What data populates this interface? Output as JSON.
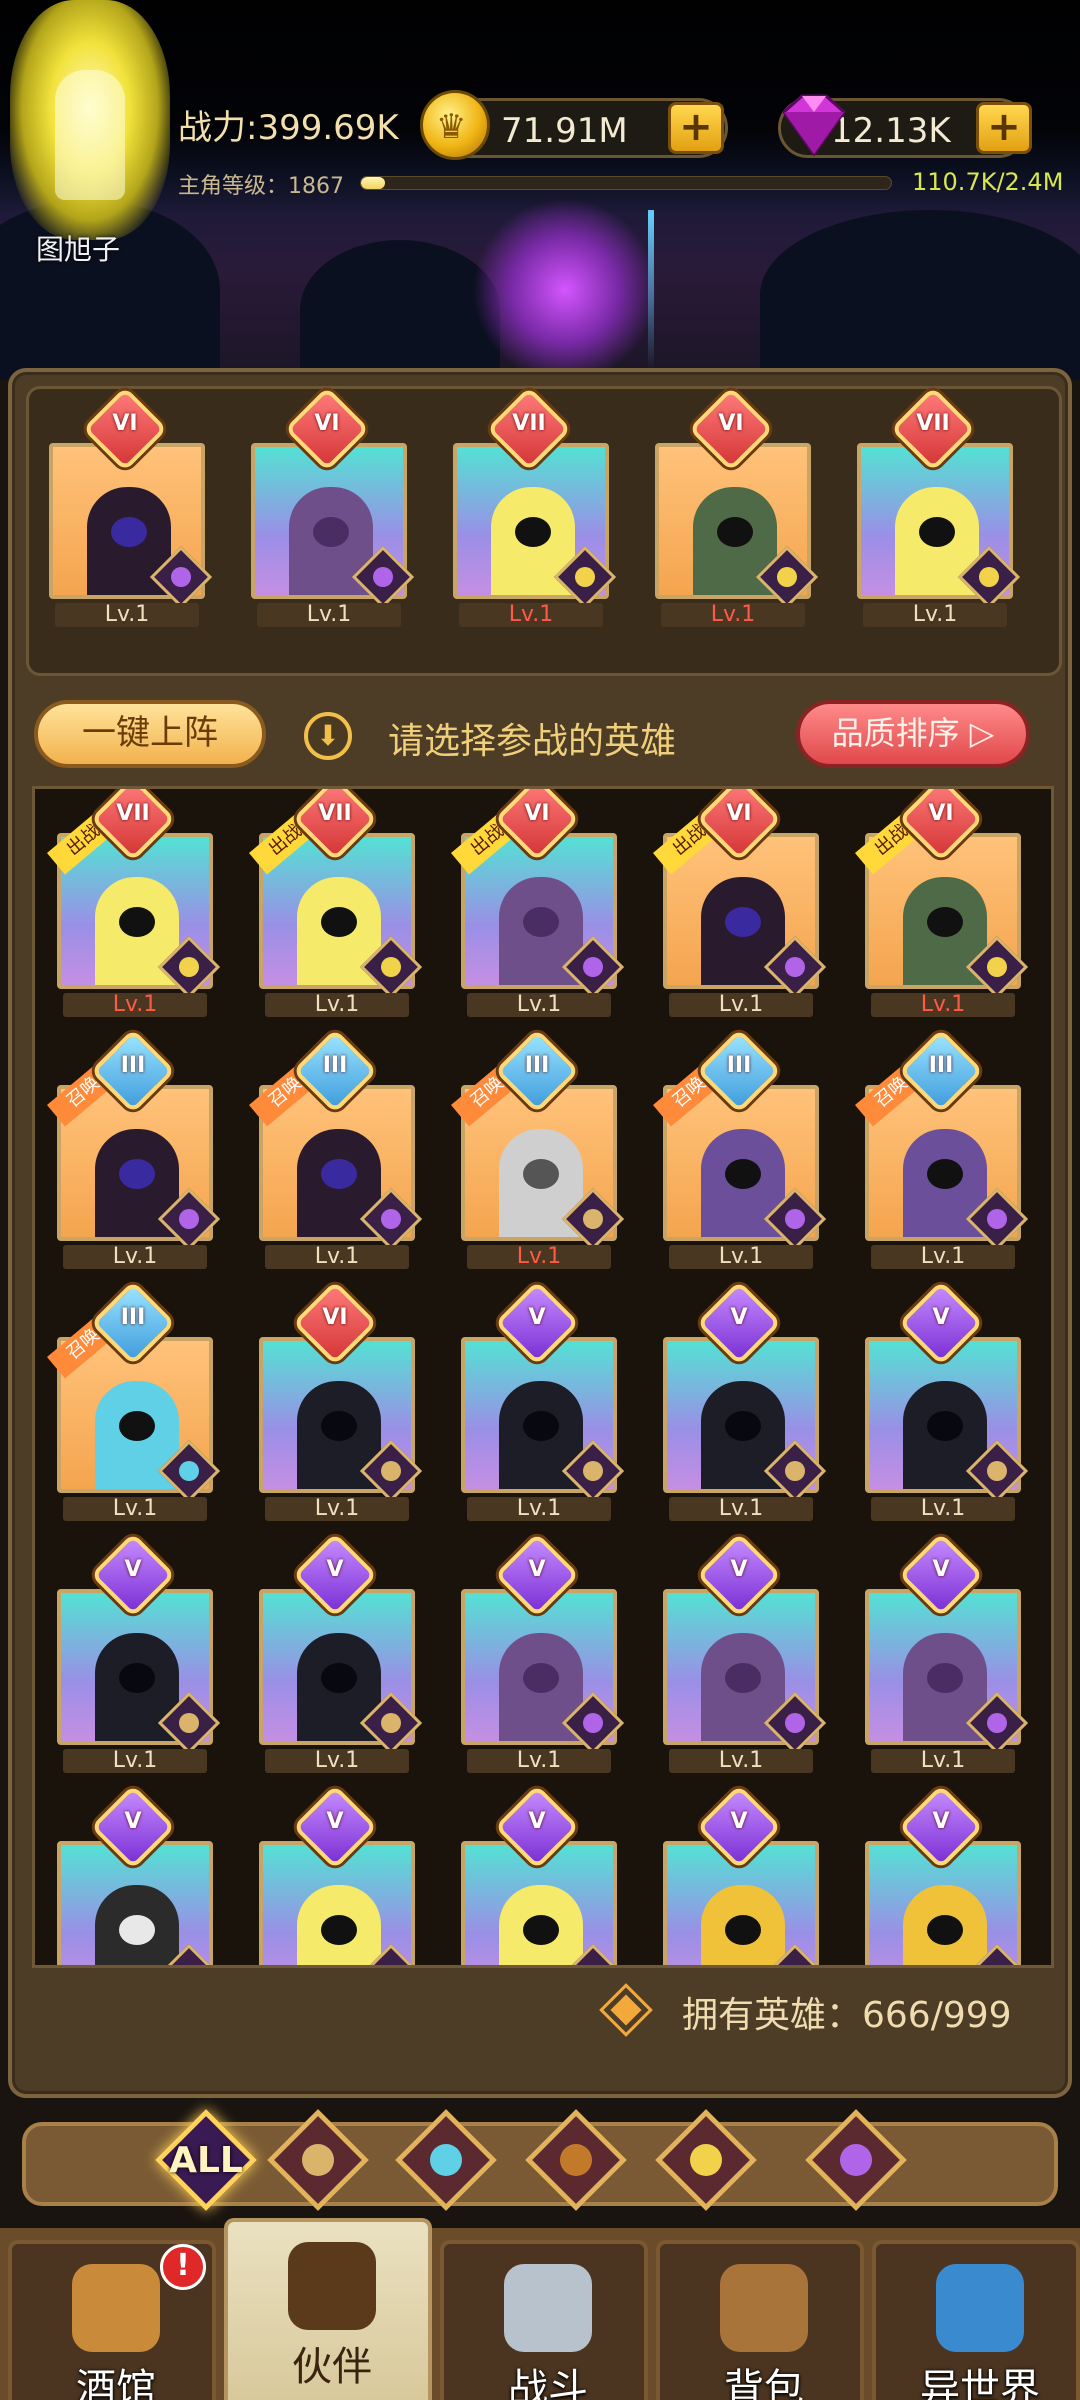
{
  "player": {
    "name": "图旭子",
    "power": "战力:399.69K",
    "level_label": "主角等级：1867",
    "level_progress": 0.046,
    "xp": "110.7K/2.4M",
    "gold": "71.91M",
    "gems": "12.13K"
  },
  "toolbar": {
    "auto_deploy": "一键上阵",
    "hint": "请选择参战的英雄",
    "sort": "品质排序"
  },
  "owned": "拥有英雄：666/999",
  "lineup": [
    {
      "rank": "VI",
      "badge": "red",
      "bg": "orange",
      "figure": "dark",
      "class": "demon",
      "level": "Lv.1",
      "level_red": false
    },
    {
      "rank": "VI",
      "badge": "red",
      "bg": "cyan",
      "figure": "purple",
      "class": "demon",
      "level": "Lv.1",
      "level_red": false
    },
    {
      "rank": "VII",
      "badge": "red",
      "bg": "cyan",
      "figure": "yellow",
      "class": "elf",
      "level": "Lv.1",
      "level_red": true
    },
    {
      "rank": "VI",
      "badge": "red",
      "bg": "orange",
      "figure": "green",
      "class": "elf",
      "level": "Lv.1",
      "level_red": true
    },
    {
      "rank": "VII",
      "badge": "red",
      "bg": "cyan",
      "figure": "yellow",
      "class": "elf",
      "level": "Lv.1",
      "level_red": false
    }
  ],
  "heroes": [
    {
      "rank": "VII",
      "badge": "red",
      "bg": "cyan",
      "figure": "yellow",
      "class": "elf",
      "level": "Lv.1",
      "level_red": true,
      "tag": "出战中",
      "tag_color": "yellow"
    },
    {
      "rank": "VII",
      "badge": "red",
      "bg": "cyan",
      "figure": "yellow",
      "class": "elf",
      "level": "Lv.1",
      "level_red": false,
      "tag": "出战中",
      "tag_color": "yellow"
    },
    {
      "rank": "VI",
      "badge": "red",
      "bg": "cyan",
      "figure": "purple",
      "class": "demon",
      "level": "Lv.1",
      "level_red": false,
      "tag": "出战中",
      "tag_color": "yellow"
    },
    {
      "rank": "VI",
      "badge": "red",
      "bg": "orange",
      "figure": "dark",
      "class": "demon",
      "level": "Lv.1",
      "level_red": false,
      "tag": "出战中",
      "tag_color": "yellow"
    },
    {
      "rank": "VI",
      "badge": "red",
      "bg": "orange",
      "figure": "green",
      "class": "elf",
      "level": "Lv.1",
      "level_red": true,
      "tag": "出战中",
      "tag_color": "yellow"
    },
    {
      "rank": "III",
      "badge": "blue",
      "bg": "orange",
      "figure": "dark",
      "class": "demon",
      "level": "Lv.1",
      "level_red": false,
      "tag": "召唤中",
      "tag_color": "orange"
    },
    {
      "rank": "III",
      "badge": "blue",
      "bg": "orange",
      "figure": "dark",
      "class": "demon",
      "level": "Lv.1",
      "level_red": false,
      "tag": "召唤中",
      "tag_color": "orange"
    },
    {
      "rank": "III",
      "badge": "blue",
      "bg": "orange",
      "figure": "knight",
      "class": "warrior",
      "level": "Lv.1",
      "level_red": true,
      "tag": "召唤中",
      "tag_color": "orange"
    },
    {
      "rank": "III",
      "badge": "blue",
      "bg": "orange",
      "figure": "orc",
      "class": "demon",
      "level": "Lv.1",
      "level_red": false,
      "tag": "召唤中",
      "tag_color": "orange"
    },
    {
      "rank": "III",
      "badge": "blue",
      "bg": "orange",
      "figure": "orc",
      "class": "demon",
      "level": "Lv.1",
      "level_red": false,
      "tag": "召唤中",
      "tag_color": "orange"
    },
    {
      "rank": "III",
      "badge": "blue",
      "bg": "orange",
      "figure": "fish",
      "class": "fish",
      "level": "Lv.1",
      "level_red": false,
      "tag": "召唤中",
      "tag_color": "orange"
    },
    {
      "rank": "VI",
      "badge": "red",
      "bg": "cyan",
      "figure": "hood",
      "class": "warrior",
      "level": "Lv.1",
      "level_red": false,
      "tag": "",
      "tag_color": ""
    },
    {
      "rank": "V",
      "badge": "purple",
      "bg": "cyan",
      "figure": "hood",
      "class": "warrior",
      "level": "Lv.1",
      "level_red": false,
      "tag": "",
      "tag_color": ""
    },
    {
      "rank": "V",
      "badge": "purple",
      "bg": "cyan",
      "figure": "hood",
      "class": "warrior",
      "level": "Lv.1",
      "level_red": false,
      "tag": "",
      "tag_color": ""
    },
    {
      "rank": "V",
      "badge": "purple",
      "bg": "cyan",
      "figure": "hood",
      "class": "warrior",
      "level": "Lv.1",
      "level_red": false,
      "tag": "",
      "tag_color": ""
    },
    {
      "rank": "V",
      "badge": "purple",
      "bg": "cyan",
      "figure": "hood",
      "class": "warrior",
      "level": "Lv.1",
      "level_red": false,
      "tag": "",
      "tag_color": ""
    },
    {
      "rank": "V",
      "badge": "purple",
      "bg": "cyan",
      "figure": "hood",
      "class": "warrior",
      "level": "Lv.1",
      "level_red": false,
      "tag": "",
      "tag_color": ""
    },
    {
      "rank": "V",
      "badge": "purple",
      "bg": "cyan",
      "figure": "purple",
      "class": "demon",
      "level": "Lv.1",
      "level_red": false,
      "tag": "",
      "tag_color": ""
    },
    {
      "rank": "V",
      "badge": "purple",
      "bg": "cyan",
      "figure": "purple",
      "class": "demon",
      "level": "Lv.1",
      "level_red": false,
      "tag": "",
      "tag_color": ""
    },
    {
      "rank": "V",
      "badge": "purple",
      "bg": "cyan",
      "figure": "purple",
      "class": "demon",
      "level": "Lv.1",
      "level_red": false,
      "tag": "",
      "tag_color": ""
    },
    {
      "rank": "V",
      "badge": "purple",
      "bg": "cyan",
      "figure": "grim",
      "class": "demon",
      "level": "",
      "level_red": false,
      "tag": "",
      "tag_color": ""
    },
    {
      "rank": "V",
      "badge": "purple",
      "bg": "cyan",
      "figure": "yellow",
      "class": "elf",
      "level": "",
      "level_red": false,
      "tag": "",
      "tag_color": ""
    },
    {
      "rank": "V",
      "badge": "purple",
      "bg": "cyan",
      "figure": "yellow",
      "class": "elf",
      "level": "",
      "level_red": false,
      "tag": "",
      "tag_color": ""
    },
    {
      "rank": "V",
      "badge": "purple",
      "bg": "cyan",
      "figure": "gold",
      "class": "warrior",
      "level": "",
      "level_red": false,
      "tag": "",
      "tag_color": ""
    },
    {
      "rank": "V",
      "badge": "purple",
      "bg": "cyan",
      "figure": "gold",
      "class": "warrior",
      "level": "",
      "level_red": false,
      "tag": "",
      "tag_color": ""
    }
  ],
  "factions": [
    {
      "label": "ALL",
      "icon": "all-icon",
      "color": "#3a1a52",
      "selected": true
    },
    {
      "label": "",
      "icon": "warrior-faction-icon",
      "color": "#d9b46a",
      "selected": false
    },
    {
      "label": "",
      "icon": "fish-faction-icon",
      "color": "#5fd0e6",
      "selected": false
    },
    {
      "label": "",
      "icon": "lion-faction-icon",
      "color": "#c27a2a",
      "selected": false
    },
    {
      "label": "",
      "icon": "elf-faction-icon",
      "color": "#f2d24a",
      "selected": false
    },
    {
      "label": "",
      "icon": "demon-faction-icon",
      "color": "#b064e8",
      "selected": false
    }
  ],
  "nav": [
    {
      "label": "酒馆",
      "icon": "beer-mug-icon",
      "color": "#c98a3a",
      "active": false
    },
    {
      "label": "伙伴",
      "icon": "partner-face-icon",
      "color": "#5a3a1a",
      "active": true
    },
    {
      "label": "战斗",
      "icon": "crossed-swords-icon",
      "color": "#b8c2cc",
      "active": false
    },
    {
      "label": "背包",
      "icon": "backpack-icon",
      "color": "#a8743a",
      "active": false
    },
    {
      "label": "异世界",
      "icon": "portal-icon",
      "color": "#3a8ad0",
      "active": false
    }
  ],
  "notification": "!"
}
